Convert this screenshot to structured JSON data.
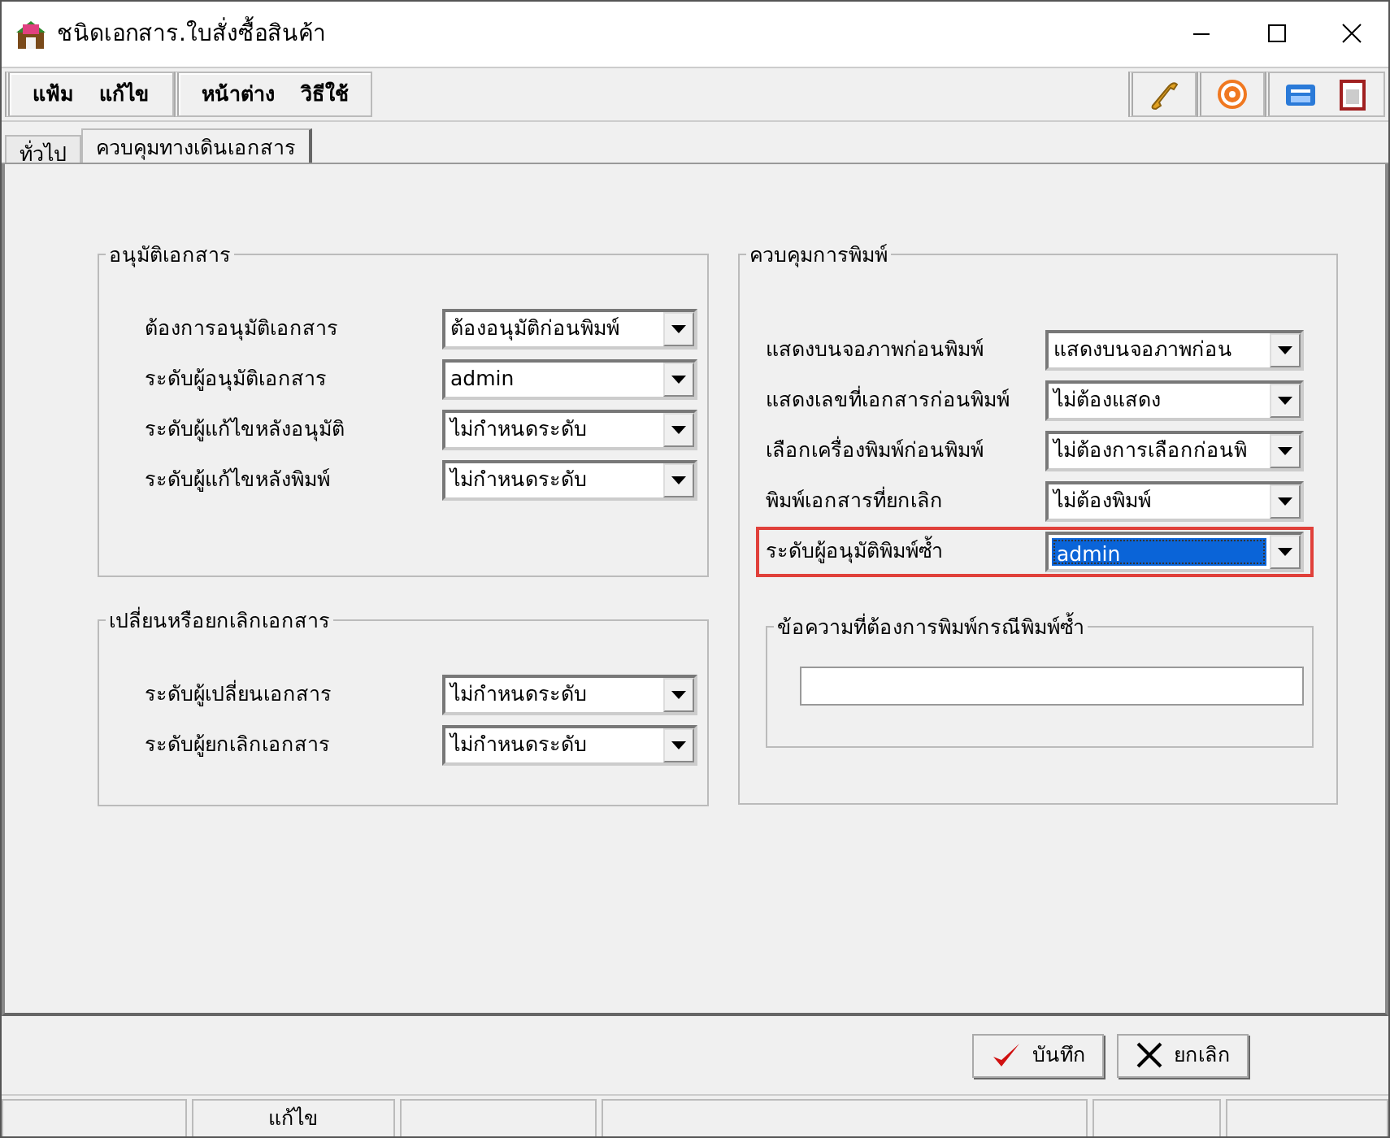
{
  "window": {
    "title": "ชนิดเอกสาร.ใบสั่งซื้อสินค้า"
  },
  "menu_groups": [
    [
      "แฟ้ม",
      "แก้ไข"
    ],
    [
      "หน้าต่าง",
      "วิธีใช้"
    ]
  ],
  "tabs": [
    {
      "label": "ทั่วไป",
      "selected": false
    },
    {
      "label": "ควบคุมทางเดินเอกสาร",
      "selected": true
    }
  ],
  "groups": [
    {
      "title": "อนุมัติเอกสาร",
      "rows": [
        {
          "label": "ต้องการอนุมัติเอกสาร",
          "value": "ต้องอนุมัติก่อนพิมพ์",
          "selected": false,
          "highlighted": false
        },
        {
          "label": "ระดับผู้อนุมัติเอกสาร",
          "value": "admin",
          "selected": false,
          "highlighted": false
        },
        {
          "label": "ระดับผู้แก้ไขหลังอนุมัติ",
          "value": "ไม่กำหนดระดับ",
          "selected": false,
          "highlighted": false
        },
        {
          "label": "ระดับผู้แก้ไขหลังพิมพ์",
          "value": "ไม่กำหนดระดับ",
          "selected": false,
          "highlighted": false
        }
      ]
    },
    {
      "title": "เปลี่ยนหรือยกเลิกเอกสาร",
      "rows": [
        {
          "label": "ระดับผู้เปลี่ยนเอกสาร",
          "value": "ไม่กำหนดระดับ",
          "selected": false,
          "highlighted": false
        },
        {
          "label": "ระดับผู้ยกเลิกเอกสาร",
          "value": "ไม่กำหนดระดับ",
          "selected": false,
          "highlighted": false
        }
      ]
    },
    {
      "title": "ควบคุมการพิมพ์",
      "rows": [
        {
          "label": "แสดงบนจอภาพก่อนพิมพ์",
          "value": "แสดงบนจอภาพก่อน",
          "selected": false,
          "highlighted": false
        },
        {
          "label": "แสดงเลขที่เอกสารก่อนพิมพ์",
          "value": "ไม่ต้องแสดง",
          "selected": false,
          "highlighted": false
        },
        {
          "label": "เลือกเครื่องพิมพ์ก่อนพิมพ์",
          "value": "ไม่ต้องการเลือกก่อนพิ",
          "selected": false,
          "highlighted": false
        },
        {
          "label": "พิมพ์เอกสารที่ยกเลิก",
          "value": "ไม่ต้องพิมพ์",
          "selected": false,
          "highlighted": false
        },
        {
          "label": "ระดับผู้อนุมัติพิมพ์ซ้ำ",
          "value": "admin",
          "selected": true,
          "highlighted": true
        }
      ],
      "subgroup": {
        "title": "ข้อความที่ต้องการพิมพ์กรณีพิมพ์ซ้ำ"
      }
    }
  ],
  "buttons": [
    {
      "label": "บันทึก",
      "kind": "save"
    },
    {
      "label": "ยกเลิก",
      "kind": "cancel"
    }
  ],
  "status_bar": {
    "mode": "แก้ไข"
  }
}
